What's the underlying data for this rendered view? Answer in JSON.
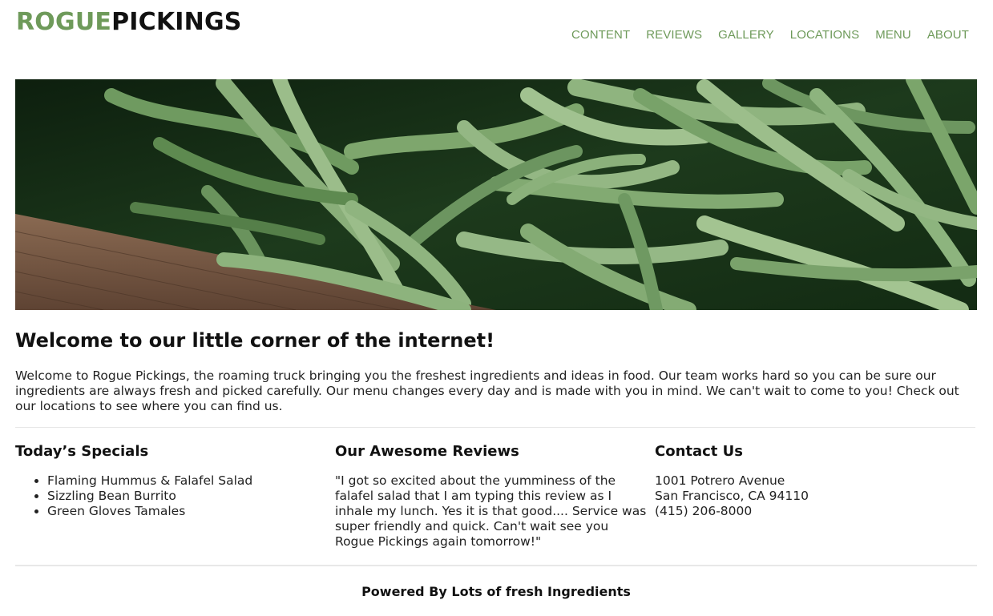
{
  "brand": {
    "part1": "ROGUE",
    "part2": "PICKINGS"
  },
  "nav": {
    "items": [
      {
        "label": "CONTENT"
      },
      {
        "label": "REVIEWS"
      },
      {
        "label": "GALLERY"
      },
      {
        "label": "LOCATIONS"
      },
      {
        "label": "MENU"
      },
      {
        "label": "ABOUT"
      }
    ]
  },
  "colors": {
    "accent": "#6e9a5a",
    "text": "#111111"
  },
  "welcome": {
    "title": "Welcome to our little corner of the internet!",
    "text": "Welcome to Rogue Pickings, the roaming truck bringing you the freshest ingredients and ideas in food. Our team works hard so you can be sure our ingredients are always fresh and picked carefully. Our menu changes every day and is made with you in mind. We can't wait to come to you! Check out our locations to see where you can find us."
  },
  "specials": {
    "title": "Today’s Specials",
    "items": [
      "Flaming Hummus & Falafel Salad",
      "Sizzling Bean Burrito",
      "Green Gloves Tamales"
    ]
  },
  "reviews": {
    "title": "Our Awesome Reviews",
    "quote": "\"I got so excited about the yumminess of the falafel salad that I am typing this review as I inhale my lunch. Yes it is that good.... Service was super friendly and quick. Can't wait see you Rogue Pickings again tomorrow!\""
  },
  "contact": {
    "title": "Contact Us",
    "street": "1001 Potrero Avenue",
    "city": "San Francisco, CA 94110",
    "phone": "(415) 206-8000"
  },
  "footer": {
    "text": "Powered By Lots of fresh Ingredients"
  }
}
